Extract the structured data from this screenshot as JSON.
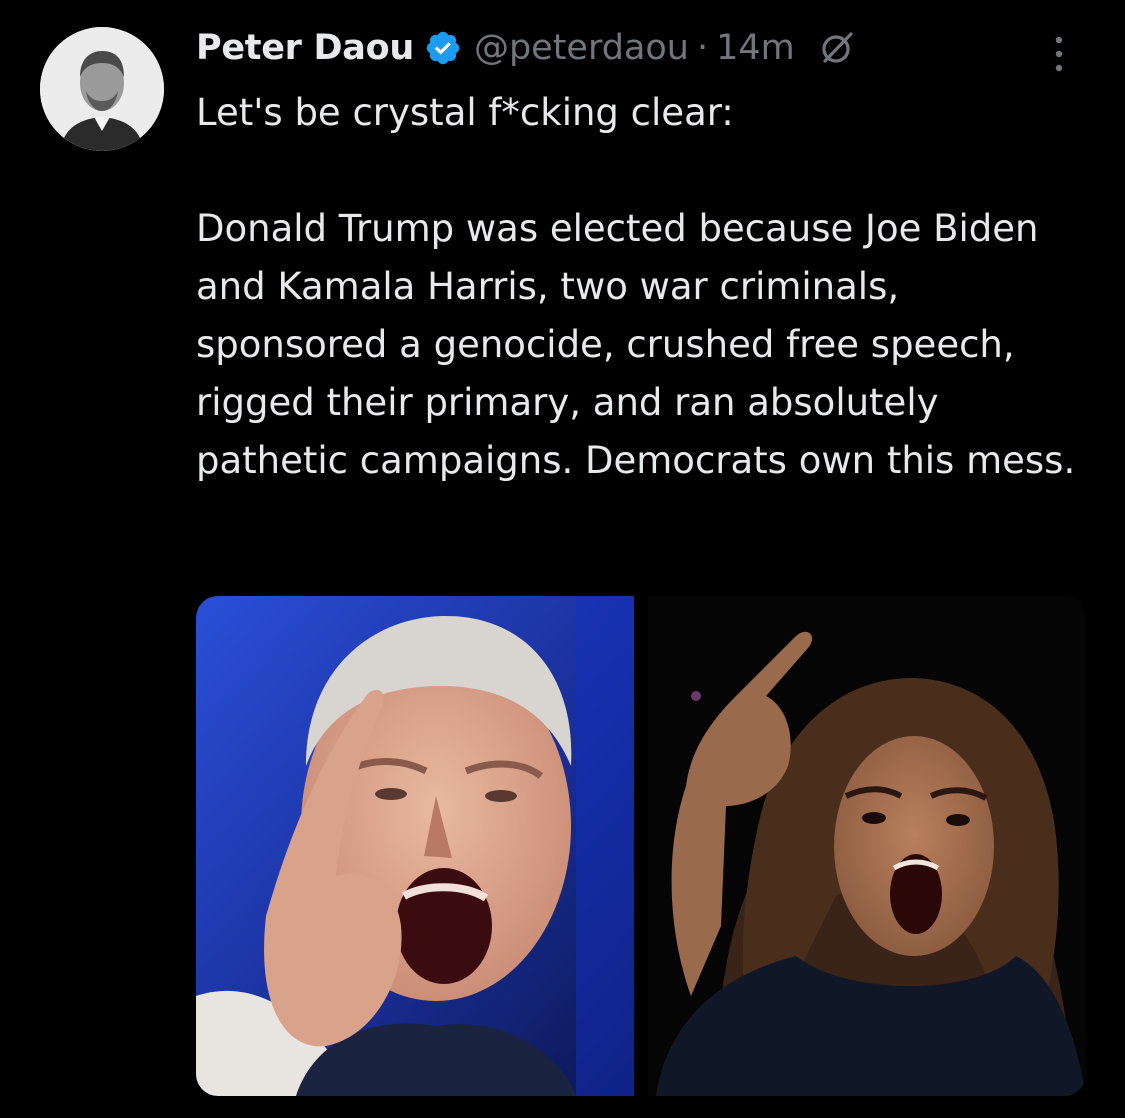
{
  "tweet": {
    "author": {
      "display_name": "Peter Daou",
      "handle": "@peterdaou",
      "verified": true,
      "avatar_icon": "avatar-photo"
    },
    "separator": "·",
    "time": "14m",
    "text_line1": "Let's be crystal f*cking clear:",
    "text_body": "Donald Trump was elected because Joe Biden and Kamala Harris, two war criminals, sponsored a genocide, crushed free speech, rigged their primary, and ran absolutely pathetic campaigns. Democrats own this mess.",
    "media_icons": [
      "photo-left-man-pointing",
      "photo-right-woman-pointing"
    ]
  },
  "colors": {
    "background": "#000000",
    "text": "#e7e9ea",
    "secondary_text": "#71767b",
    "verified_blue": "#1d9bf0"
  }
}
